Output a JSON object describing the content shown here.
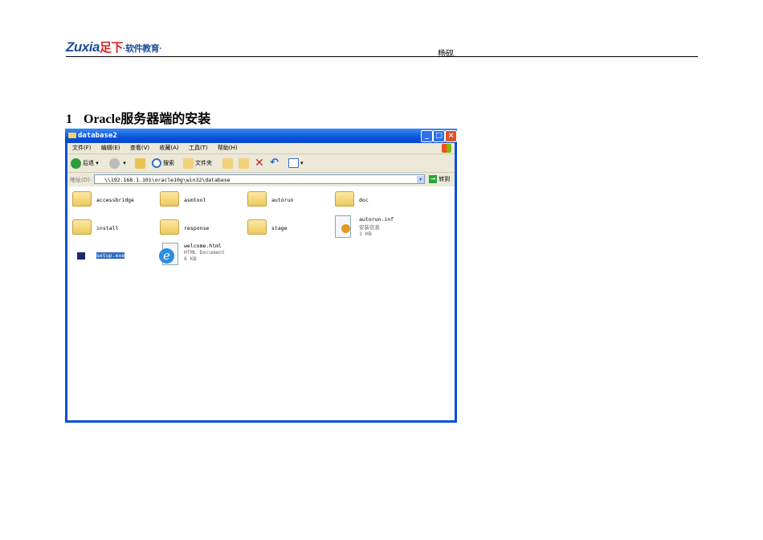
{
  "header": {
    "logo": "Zuxia足下·软件教育·",
    "logo_latin": "Zuxia",
    "logo_cn": "足下",
    "logo_sub": "·软件教育·",
    "author": "杨砚"
  },
  "section": {
    "number": "1",
    "title": "Oracle服务器端的安装"
  },
  "window": {
    "title": "database2",
    "menu": [
      "文件(F)",
      "编辑(E)",
      "查看(V)",
      "收藏(A)",
      "工具(T)",
      "帮助(H)"
    ],
    "toolbar": {
      "back": "后退",
      "search": "搜索",
      "folders": "文件夹"
    },
    "address": {
      "label": "地址(D)",
      "value": "\\\\192.168.1.101\\oracle10g\\win32\\database",
      "go": "转到"
    },
    "items": [
      {
        "name": "accessbridge",
        "type": "folder"
      },
      {
        "name": "asmtool",
        "type": "folder"
      },
      {
        "name": "autorun",
        "type": "folder"
      },
      {
        "name": "doc",
        "type": "folder"
      },
      {
        "name": "install",
        "type": "folder"
      },
      {
        "name": "response",
        "type": "folder"
      },
      {
        "name": "stage",
        "type": "folder"
      },
      {
        "name": "autorun.inf",
        "type": "inf",
        "desc": "安装信息",
        "size": "1 KB"
      },
      {
        "name": "setup.exe",
        "type": "exe",
        "selected": true
      },
      {
        "name": "welcome.html",
        "type": "html",
        "desc": "HTML Document",
        "size": "6 KB"
      }
    ]
  }
}
